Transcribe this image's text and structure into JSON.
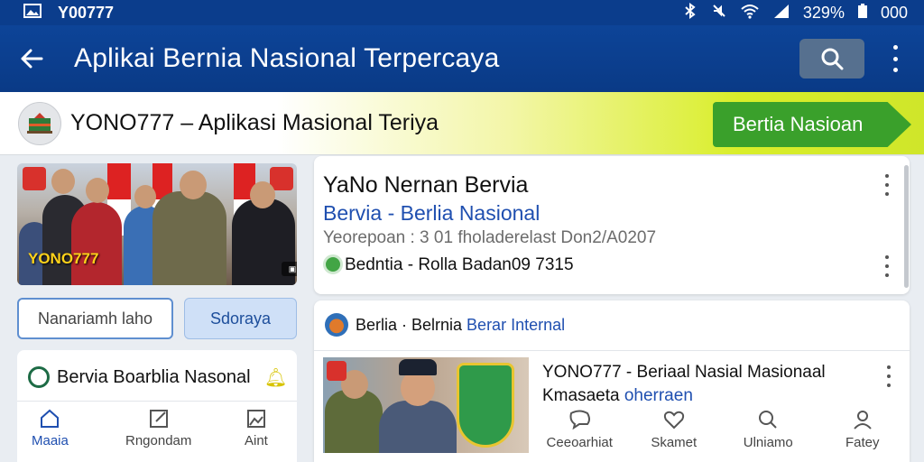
{
  "status_bar": {
    "carrier": "Y00777",
    "battery": "329%",
    "extra": "000"
  },
  "app_bar": {
    "title": "Aplikai Bernia Nasional Terpercaya"
  },
  "banner": {
    "title": "YONO777 – Aplikasi Masional Teriya",
    "cta": "Bertia Nasioan"
  },
  "photo": {
    "watermark": "YONO777"
  },
  "buttons": {
    "outline": "Nanariamh laho",
    "filled": "Sdoraya"
  },
  "left_card": {
    "title": "Bervia Boarblia Nasonal",
    "nav": [
      {
        "label": "Maaia",
        "icon": "home-icon"
      },
      {
        "label": "Rngondam",
        "icon": "edit-icon"
      },
      {
        "label": "Aint",
        "icon": "image-icon"
      }
    ]
  },
  "featured_card": {
    "headline": "YaNo Nernan Bervia",
    "subheadline": "Bervia - Berlia Nasional",
    "meta": "Yeorepoan : 3 01 fholaderelast Don2/A0207",
    "source": "Bedntia - Rolla Badan09 7315"
  },
  "news_card": {
    "header_prefix": "Berlia · Belrnia ",
    "header_link": "Berar Internal",
    "item_title": "YONO777 - Beriaal Nasial Masionaal",
    "item_sub_prefix": "Kmasaeta ",
    "item_sub_link": "oherraen"
  },
  "bottom_nav": [
    {
      "label": "Ceeoarhiat",
      "icon": "chat-icon"
    },
    {
      "label": "Skamet",
      "icon": "heart-icon"
    },
    {
      "label": "Ulniamo",
      "icon": "search-icon"
    },
    {
      "label": "Fatey",
      "icon": "profile-icon"
    }
  ],
  "colors": {
    "primary": "#0b3d8c",
    "accent_green": "#3aa02b",
    "link_blue": "#1f4fb0"
  }
}
